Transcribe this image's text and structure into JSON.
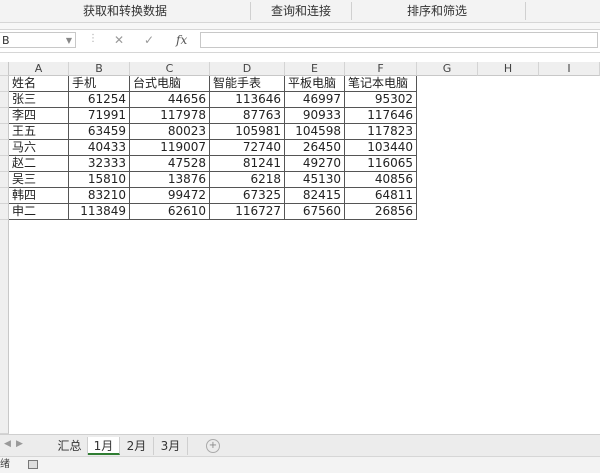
{
  "ribbon": {
    "groups": [
      "获取和转换数据",
      "查询和连接",
      "排序和筛选"
    ]
  },
  "formula_bar": {
    "name_box": "B",
    "fx": "fx",
    "value": ""
  },
  "columns": [
    "A",
    "B",
    "C",
    "D",
    "E",
    "F",
    "G",
    "H",
    "I"
  ],
  "table": {
    "headers": [
      "姓名",
      "手机",
      "台式电脑",
      "智能手表",
      "平板电脑",
      "笔记本电脑"
    ],
    "rows": [
      [
        "张三",
        "61254",
        "44656",
        "113646",
        "46997",
        "95302"
      ],
      [
        "李四",
        "71991",
        "117978",
        "87763",
        "90933",
        "117646"
      ],
      [
        "王五",
        "63459",
        "80023",
        "105981",
        "104598",
        "117823"
      ],
      [
        "马六",
        "40433",
        "119007",
        "72740",
        "26450",
        "103440"
      ],
      [
        "赵二",
        "32333",
        "47528",
        "81241",
        "49270",
        "116065"
      ],
      [
        "吴三",
        "15810",
        "13876",
        "6218",
        "45130",
        "40856"
      ],
      [
        "韩四",
        "83210",
        "99472",
        "67325",
        "82415",
        "64811"
      ],
      [
        "申二",
        "113849",
        "62610",
        "116727",
        "67560",
        "26856"
      ]
    ]
  },
  "sheet_tabs": [
    "汇总",
    "1月",
    "2月",
    "3月"
  ],
  "active_tab": "1月",
  "status": {
    "ready": "绪"
  }
}
